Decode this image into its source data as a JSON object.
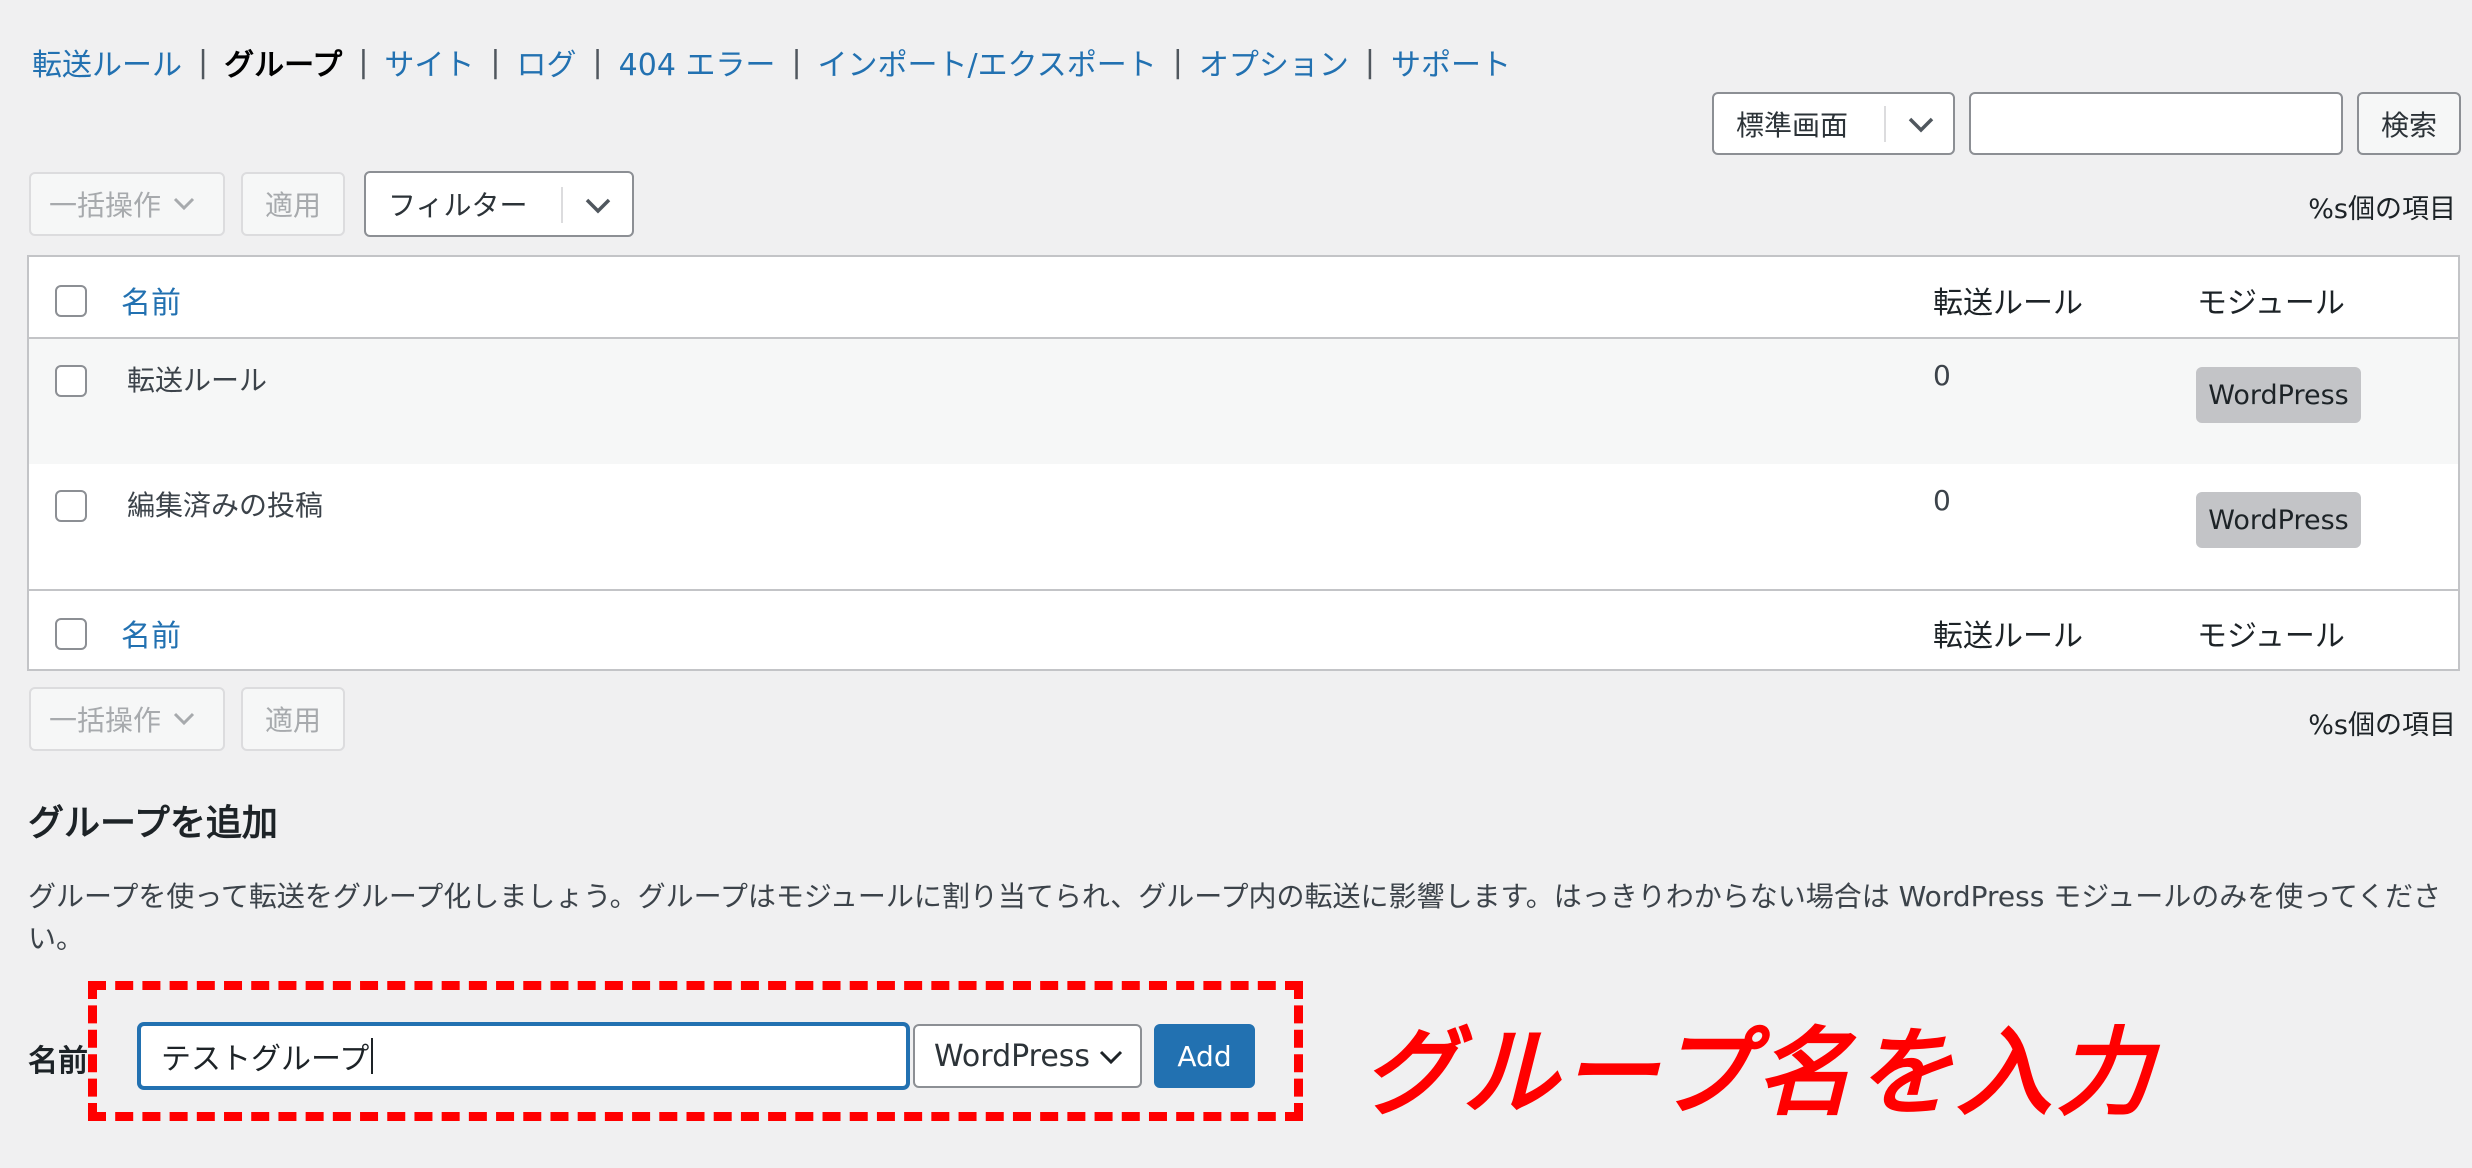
{
  "nav": {
    "items": [
      {
        "label": "転送ルール",
        "current": false
      },
      {
        "label": "グループ",
        "current": true
      },
      {
        "label": "サイト",
        "current": false
      },
      {
        "label": "ログ",
        "current": false
      },
      {
        "label": "404 エラー",
        "current": false
      },
      {
        "label": "インポート/エクスポート",
        "current": false
      },
      {
        "label": "オプション",
        "current": false
      },
      {
        "label": "サポート",
        "current": false
      }
    ],
    "separator": "|"
  },
  "top_controls": {
    "view_select": "標準画面",
    "search_value": "",
    "search_button": "検索"
  },
  "toolbar_top": {
    "bulk_action": "一括操作",
    "apply": "適用",
    "filter": "フィルター",
    "count": "%s個の項目"
  },
  "table": {
    "columns": {
      "name": "名前",
      "rules": "転送ルール",
      "module": "モジュール"
    },
    "rows": [
      {
        "name": "転送ルール",
        "rules": "0",
        "module": "WordPress"
      },
      {
        "name": "編集済みの投稿",
        "rules": "0",
        "module": "WordPress"
      }
    ]
  },
  "toolbar_bottom": {
    "bulk_action": "一括操作",
    "apply": "適用",
    "count": "%s個の項目"
  },
  "add_group": {
    "title": "グループを追加",
    "description": "グループを使って転送をグループ化しましょう。グループはモジュールに割り当てられ、グループ内の転送に影響します。はっきりわからない場合は WordPress モジュールのみを使ってください。",
    "name_label": "名前",
    "name_value": "テストグループ",
    "module_select": "WordPress",
    "add_button": "Add"
  },
  "annotation": {
    "text": "グループ名を入力",
    "color": "#ff0000"
  },
  "colors": {
    "link": "#2271b1",
    "primary": "#2271b1",
    "background": "#f0f0f1"
  }
}
